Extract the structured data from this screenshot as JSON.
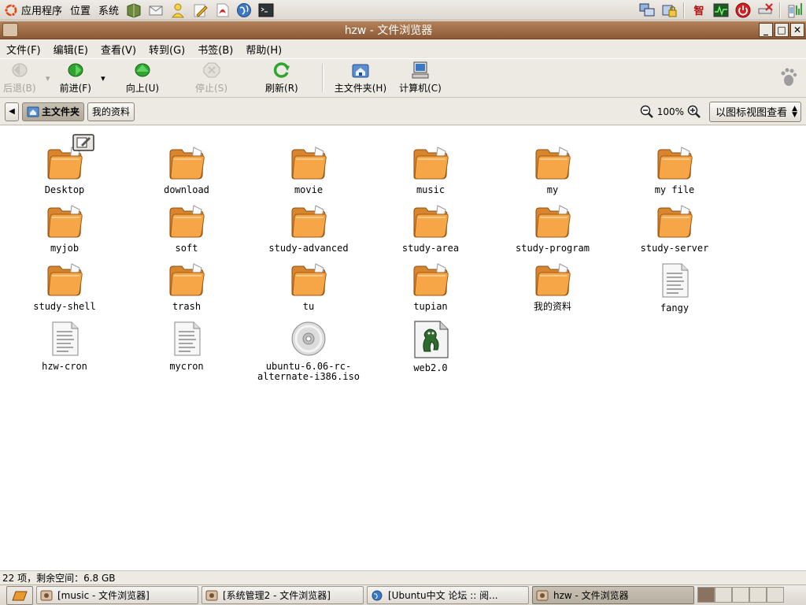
{
  "top_panel": {
    "menus": [
      "应用程序",
      "位置",
      "系统"
    ],
    "launchers": [
      "book-icon",
      "mail-icon",
      "people-icon",
      "editor-icon",
      "pdf-icon",
      "browser-globe-icon",
      "terminal-icon"
    ],
    "tray_icons": [
      "network-icon",
      "lock-icon",
      "input-method-icon",
      "system-monitor-icon",
      "power-icon",
      "remove-icon",
      "volume-icon"
    ],
    "input_method_label": "智"
  },
  "window": {
    "title": "hzw - 文件浏览器",
    "buttons": {
      "minimize": "_",
      "maximize": "□",
      "close": "✕"
    }
  },
  "menubar": [
    "文件(F)",
    "编辑(E)",
    "查看(V)",
    "转到(G)",
    "书签(B)",
    "帮助(H)"
  ],
  "toolbar": {
    "back": "后退(B)",
    "forward": "前进(F)",
    "up": "向上(U)",
    "stop": "停止(S)",
    "reload": "刷新(R)",
    "home": "主文件夹(H)",
    "computer": "计算机(C)"
  },
  "location": {
    "path": [
      "主文件夹",
      "我的资料"
    ],
    "zoom": "100%",
    "view_mode": "以图标视图查看"
  },
  "files": [
    {
      "name": "Desktop",
      "type": "folder"
    },
    {
      "name": "download",
      "type": "folder"
    },
    {
      "name": "movie",
      "type": "folder"
    },
    {
      "name": "music",
      "type": "folder"
    },
    {
      "name": "my",
      "type": "folder"
    },
    {
      "name": "my file",
      "type": "folder"
    },
    {
      "name": "myjob",
      "type": "folder"
    },
    {
      "name": "soft",
      "type": "folder"
    },
    {
      "name": "study-advanced",
      "type": "folder"
    },
    {
      "name": "study-area",
      "type": "folder"
    },
    {
      "name": "study-program",
      "type": "folder"
    },
    {
      "name": "study-server",
      "type": "folder"
    },
    {
      "name": "study-shell",
      "type": "folder"
    },
    {
      "name": "trash",
      "type": "folder"
    },
    {
      "name": "tu",
      "type": "folder"
    },
    {
      "name": "tupian",
      "type": "folder"
    },
    {
      "name": "我的资料",
      "type": "folder"
    },
    {
      "name": "fangy",
      "type": "text"
    },
    {
      "name": "hzw-cron",
      "type": "text"
    },
    {
      "name": "mycron",
      "type": "text"
    },
    {
      "name": "ubuntu-6.06-rc-\nalternate-i386.iso",
      "type": "disc"
    },
    {
      "name": "web2.0",
      "type": "gimp"
    }
  ],
  "status": "22 项，剩余空间：6.8 GB",
  "taskbar": [
    {
      "label": "[music - 文件浏览器]",
      "active": false
    },
    {
      "label": "[系统管理2 - 文件浏览器]",
      "active": false
    },
    {
      "label": "[Ubuntu中文 论坛 :: 阅...",
      "active": false
    },
    {
      "label": "hzw - 文件浏览器",
      "active": true
    }
  ],
  "colors": {
    "titlebar": "#9b6a43",
    "folder": "#f3a145",
    "panel": "#e6e1da"
  }
}
